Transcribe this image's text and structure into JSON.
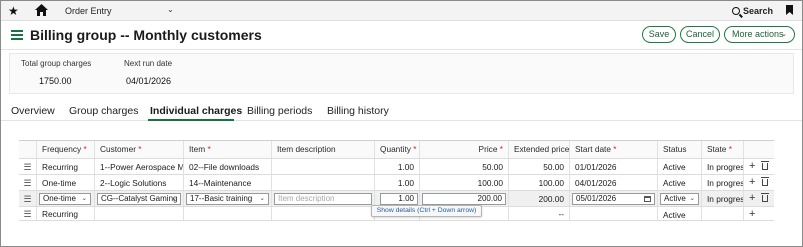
{
  "topbar": {
    "module": "Order Entry",
    "search_label": "Search"
  },
  "header": {
    "title": "Billing group -- Monthly customers",
    "save_label": "Save",
    "cancel_label": "Cancel",
    "more_label": "More actions"
  },
  "summary": {
    "total_label": "Total group charges",
    "total_value": "1750.00",
    "next_run_label": "Next run date",
    "next_run_value": "04/01/2026"
  },
  "tabs": [
    "Overview",
    "Group charges",
    "Individual charges",
    "Billing periods",
    "Billing history"
  ],
  "active_tab": "Individual charges",
  "grid": {
    "columns": [
      "Frequency",
      "Customer",
      "Item",
      "Item description",
      "Quantity",
      "Price",
      "Extended price",
      "Start date",
      "Status",
      "State"
    ],
    "required": [
      "Frequency",
      "Customer",
      "Item",
      "Quantity",
      "Price",
      "Extended price",
      "Start date",
      "State"
    ],
    "rows": [
      {
        "frequency": "Recurring",
        "customer": "1--Power Aerospace M",
        "item": "02--File downloads",
        "description": "",
        "quantity": "1.00",
        "price": "50.00",
        "extended": "50.00",
        "start": "01/01/2026",
        "status": "Active",
        "state": "In progress"
      },
      {
        "frequency": "One-time",
        "customer": "2--Logic Solutions",
        "item": "14--Maintenance",
        "description": "",
        "quantity": "1.00",
        "price": "100.00",
        "extended": "100.00",
        "start": "04/01/2026",
        "status": "Active",
        "state": "In progress"
      },
      {
        "frequency": "One-time",
        "customer": "CG--Catalyst Gaming",
        "item": "17--Basic training",
        "description_placeholder": "Item description",
        "quantity": "1.00",
        "price": "200.00",
        "extended": "200.00",
        "start": "05/01/2026",
        "status": "Active",
        "state": "In progress"
      },
      {
        "frequency": "Recurring",
        "customer": "",
        "item": "",
        "description": "",
        "quantity": "",
        "price": "",
        "extended": "--",
        "start": "",
        "status": "Active",
        "state": ""
      }
    ],
    "tooltip": "Show details (Ctrl + Down arrow)"
  }
}
